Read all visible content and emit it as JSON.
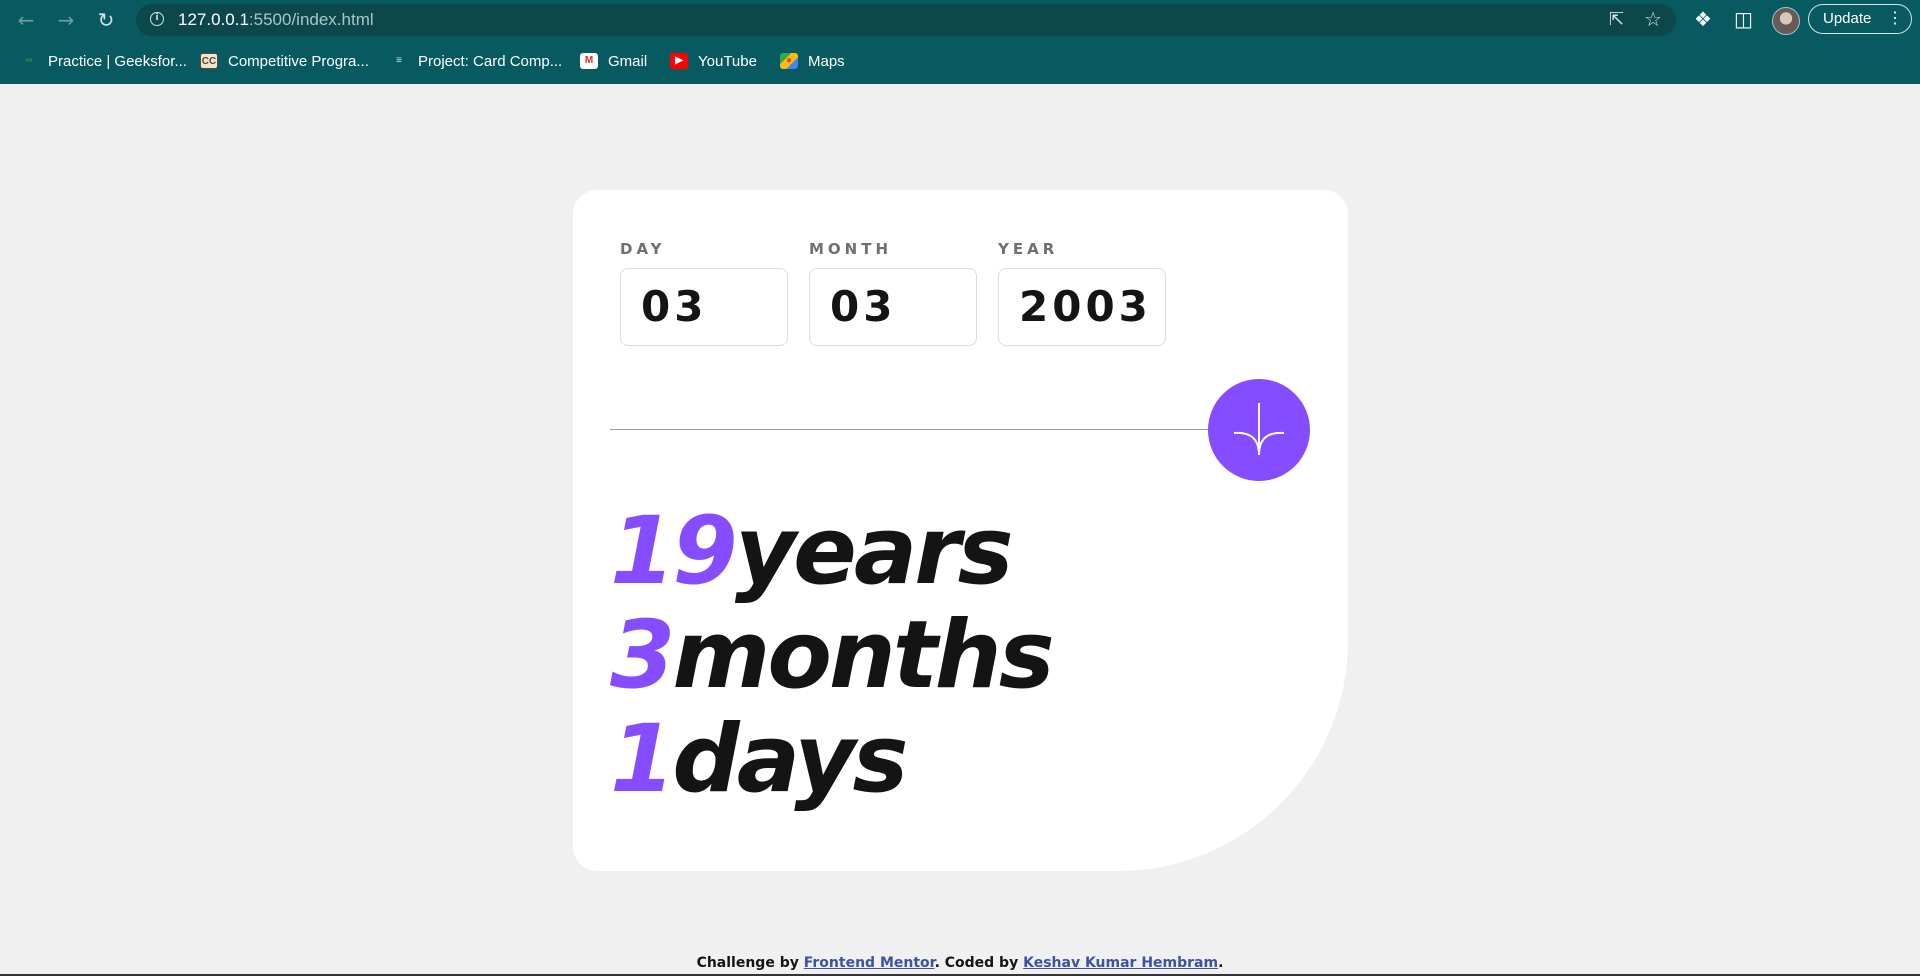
{
  "browser": {
    "url_host": "127.0.0.1",
    "url_path": ":5500/index.html",
    "update_label": "Update",
    "bookmarks": [
      {
        "label": "Practice | Geeksfor...",
        "icon": "geeksforgeeks-icon"
      },
      {
        "label": "Competitive Progra...",
        "icon": "codechef-icon"
      },
      {
        "label": "Project: Card Comp...",
        "icon": "project-icon"
      },
      {
        "label": "Gmail",
        "icon": "gmail-icon"
      },
      {
        "label": "YouTube",
        "icon": "youtube-icon"
      },
      {
        "label": "Maps",
        "icon": "maps-icon"
      }
    ]
  },
  "form": {
    "day": {
      "label": "DAY",
      "value": "03"
    },
    "month": {
      "label": "MONTH",
      "value": "03"
    },
    "year": {
      "label": "YEAR",
      "value": "2003"
    }
  },
  "results": {
    "years": {
      "value": "19",
      "unit": "years"
    },
    "months": {
      "value": "3",
      "unit": "months"
    },
    "days": {
      "value": "1",
      "unit": "days"
    }
  },
  "footer": {
    "prefix": "Challenge by ",
    "link1": "Frontend Mentor",
    "middle": ". Coded by ",
    "link2": "Keshav Kumar Hembram",
    "suffix": "."
  },
  "colors": {
    "accent": "#854dff",
    "chrome": "#075a60",
    "background": "#f0f0f0"
  }
}
